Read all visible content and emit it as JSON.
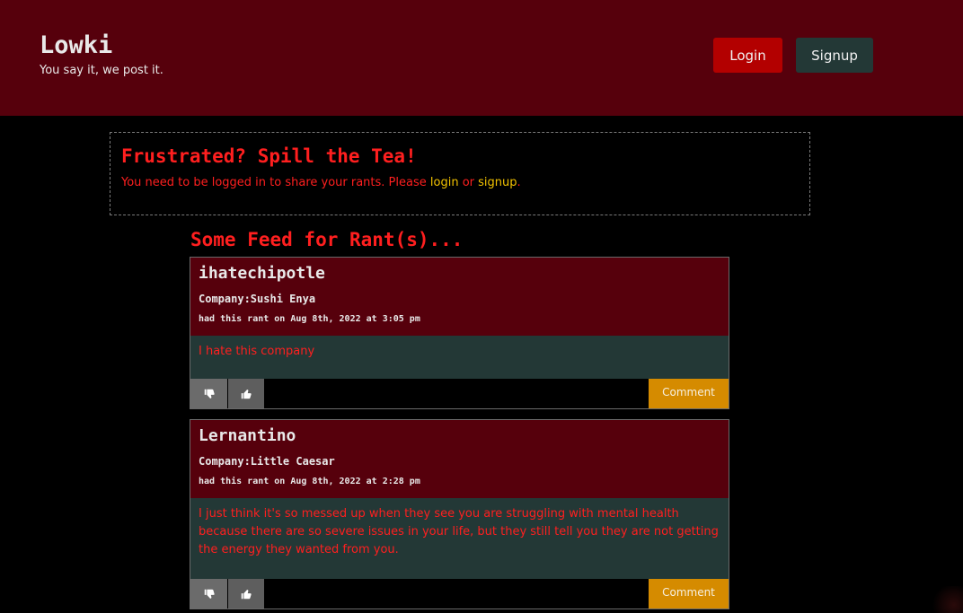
{
  "header": {
    "title": "Lowki",
    "tagline": "You say it, we post it.",
    "login_label": "Login",
    "signup_label": "Signup"
  },
  "share": {
    "title": "Frustrated? Spill the Tea!",
    "text_before": "You need to be logged in to share your rants. Please ",
    "login_link": "login",
    "text_middle": " or ",
    "signup_link": "signup",
    "text_after": "."
  },
  "feed": {
    "heading": "Some Feed for Rant(s)...",
    "posts": [
      {
        "username": "ihatechipotle",
        "company": "Company:Sushi Enya",
        "date": "had this rant on Aug 8th, 2022 at 3:05 pm",
        "body": "I hate this company",
        "comment_label": "Comment"
      },
      {
        "username": "Lernantino",
        "company": "Company:Little Caesar",
        "date": "had this rant on Aug 8th, 2022 at 2:28 pm",
        "body": "I just think it's so messed up when they see you are struggling with mental health because there are so severe issues in your life, but they still tell you they are not getting the energy they wanted from you.",
        "comment_label": "Comment"
      }
    ]
  },
  "colors": {
    "header_bg": "#56000c",
    "accent_red": "#ff1f1f",
    "link_yellow": "#f2c200",
    "body_teal": "#233836",
    "comment_orange": "#d58b00"
  },
  "icons": {
    "vote_down": "thumbs-down-icon",
    "vote_up": "thumbs-up-icon"
  }
}
